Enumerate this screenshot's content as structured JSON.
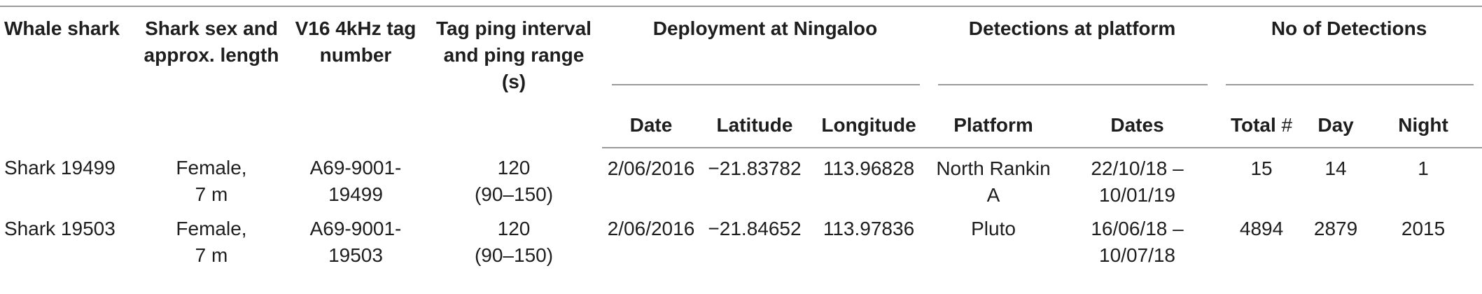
{
  "headers": {
    "whale_shark": "Whale shark",
    "shark_sex_length": [
      "Shark sex and",
      "approx. length"
    ],
    "tag_number": [
      "V16 4kHz tag",
      "number"
    ],
    "ping_interval": [
      "Tag ping interval",
      "and ping range",
      "(s)"
    ],
    "deployment": "Deployment at Ningaloo",
    "detections_platform": "Detections at platform",
    "num_detections": "No of Detections",
    "sub": {
      "date": "Date",
      "latitude": "Latitude",
      "longitude": "Longitude",
      "platform": "Platform",
      "dates": "Dates",
      "total": "Total",
      "total_hash": "#",
      "day": "Day",
      "night": "Night"
    }
  },
  "rows": [
    {
      "shark": "Shark 19499",
      "sex_length": [
        "Female,",
        "7 m"
      ],
      "tag": [
        "A69-9001-",
        "19499"
      ],
      "ping": [
        "120",
        "(90–150)"
      ],
      "date": "2/06/2016",
      "latitude": "−21.83782",
      "longitude": "113.96828",
      "platform": "North Rankin A",
      "dates": [
        "22/10/18 –",
        "10/01/19"
      ],
      "total": "15",
      "day": "14",
      "night": "1"
    },
    {
      "shark": "Shark 19503",
      "sex_length": [
        "Female,",
        "7 m"
      ],
      "tag": [
        "A69-9001-",
        "19503"
      ],
      "ping": [
        "120",
        "(90–150)"
      ],
      "date": "2/06/2016",
      "latitude": "−21.84652",
      "longitude": "113.97836",
      "platform": "Pluto",
      "dates": [
        "16/06/18 –",
        "10/07/18"
      ],
      "total": "4894",
      "day": "2879",
      "night": "2015"
    }
  ]
}
